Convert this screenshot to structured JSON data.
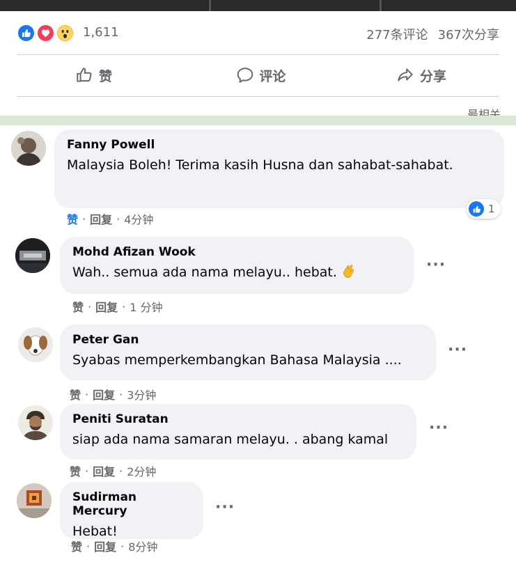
{
  "post": {
    "reaction_count": "1,611",
    "comments_count": "277条评论",
    "shares_count": "367次分享",
    "actions": {
      "like": "赞",
      "comment": "评论",
      "share": "分享"
    },
    "sort_label": "最相关"
  },
  "comments": [
    {
      "author": "Fanny Powell",
      "text": "Malaysia Boleh! Terima kasih Husna dan sahabat-sahabat.",
      "like_label": "赞",
      "reply_label": "回复",
      "time": "4分钟",
      "reactions": "1"
    },
    {
      "author": "Mohd Afizan Wook",
      "text": "Wah.. semua ada nama melayu.. hebat.",
      "like_label": "赞",
      "reply_label": "回复",
      "time": "1 分钟"
    },
    {
      "author": "Peter Gan",
      "text": "Syabas memperkembangkan Bahasa Malaysia ....",
      "like_label": "赞",
      "reply_label": "回复",
      "time": "3分钟"
    },
    {
      "author": "Peniti Suratan",
      "text": "siap ada nama samaran melayu. . abang kamal",
      "like_label": "赞",
      "reply_label": "回复",
      "time": "2分钟"
    },
    {
      "author": "Sudirman Mercury",
      "text": "Hebat!",
      "like_label": "赞",
      "reply_label": "回复",
      "time": "8分钟"
    }
  ],
  "colors": {
    "accent": "#1877f2",
    "bubble": "#f0f2f5",
    "secondary_text": "#65676b"
  },
  "icons": [
    "like-reaction-icon",
    "love-reaction-icon",
    "wow-reaction-icon",
    "thumbs-up-icon",
    "comment-icon",
    "share-icon",
    "more-icon",
    "clap-emoji-icon"
  ]
}
